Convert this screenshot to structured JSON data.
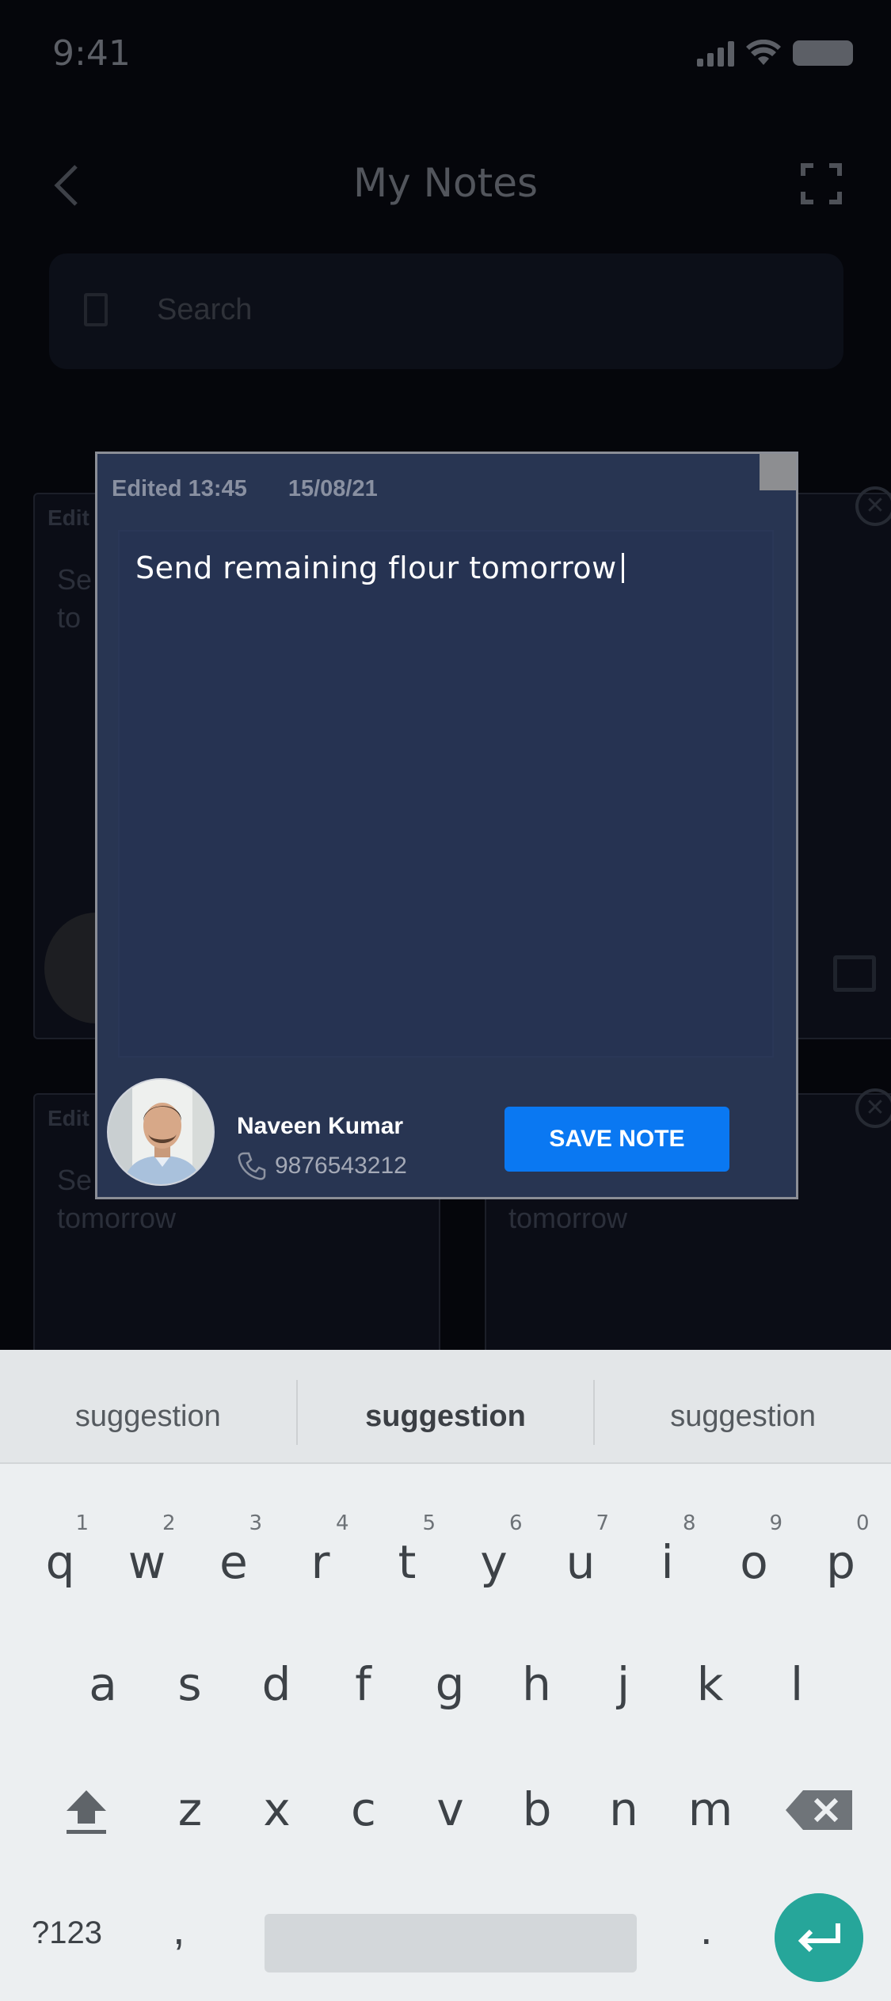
{
  "status_bar": {
    "time": "9:41"
  },
  "header": {
    "title": "My Notes"
  },
  "search": {
    "placeholder": "Search"
  },
  "background_cards": [
    {
      "edited": "Edit",
      "text": "Se\nto"
    },
    {
      "edited": "Edit",
      "text": "Se\ntomorrow"
    },
    {
      "edited": "",
      "text": "tomorrow"
    }
  ],
  "dialog": {
    "edited_label": "Edited 13:45",
    "date": "15/08/21",
    "note_text": "Send remaining flour tomorrow",
    "contact": {
      "name": "Naveen Kumar",
      "phone": "9876543212"
    },
    "save_label": "SAVE NOTE"
  },
  "keyboard": {
    "suggestions": [
      "suggestion",
      "suggestion",
      "suggestion"
    ],
    "row1": [
      {
        "k": "q",
        "h": "1"
      },
      {
        "k": "w",
        "h": "2"
      },
      {
        "k": "e",
        "h": "3"
      },
      {
        "k": "r",
        "h": "4"
      },
      {
        "k": "t",
        "h": "5"
      },
      {
        "k": "y",
        "h": "6"
      },
      {
        "k": "u",
        "h": "7"
      },
      {
        "k": "i",
        "h": "8"
      },
      {
        "k": "o",
        "h": "9"
      },
      {
        "k": "p",
        "h": "0"
      }
    ],
    "row2": [
      "a",
      "s",
      "d",
      "f",
      "g",
      "h",
      "j",
      "k",
      "l"
    ],
    "row3": [
      "z",
      "x",
      "c",
      "v",
      "b",
      "n",
      "m"
    ],
    "numbers_label": "?123",
    "comma": ",",
    "period": "."
  },
  "colors": {
    "dialog_bg": "#283552",
    "accent_button": "#0a78f2",
    "enter_key": "#26a69a",
    "keyboard_bg": "#eceff1"
  }
}
